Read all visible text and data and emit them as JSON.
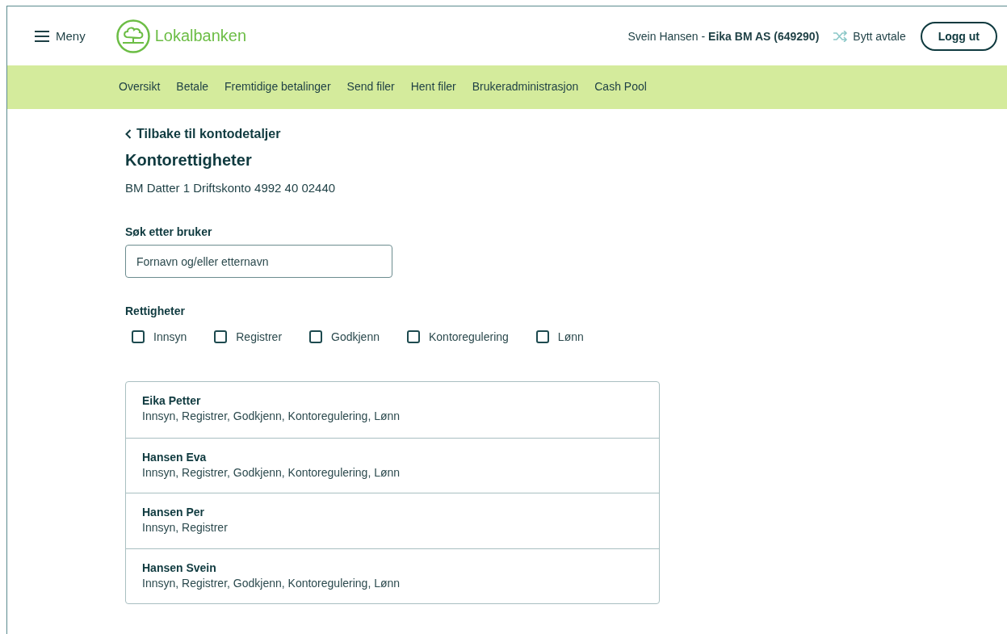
{
  "header": {
    "menu_label": "Meny",
    "logo_text": "Lokalbanken",
    "account": "Svein Hansen - **Eika BM AS (649290)**",
    "switch_label": "Bytt avtale",
    "logout_label": "Logg ut"
  },
  "nav": [
    {
      "label": "Oversikt",
      "selected": false
    },
    {
      "label": "Betale",
      "selected": false
    },
    {
      "label": "Fremtidige betalinger",
      "selected": false
    },
    {
      "label": "Send filer",
      "selected": false
    },
    {
      "label": "Hent filer",
      "selected": false
    },
    {
      "label": "Brukeradministrasjon",
      "selected": false
    },
    {
      "label": "Cash Pool",
      "selected": false
    }
  ],
  "back_link": "Tilbake til kontodetaljer",
  "title": "Kontorettigheter",
  "account_line": "BM Datter 1 Driftskonto 4992 40 02440",
  "search": {
    "label": "Søk etter bruker",
    "placeholder": "Fornavn og/eller etternavn"
  },
  "rights": {
    "label": "Rettigheter",
    "options": [
      {
        "label": "Innsyn",
        "checked": false
      },
      {
        "label": "Registrer",
        "checked": false
      },
      {
        "label": "Godkjenn",
        "checked": false
      },
      {
        "label": "Kontoregulering",
        "checked": false
      },
      {
        "label": "Lønn",
        "checked": false
      }
    ]
  },
  "users": [
    {
      "name": "Eika Petter",
      "rights": "Innsyn, Registrer, Godkjenn, Kontoregulering, Lønn"
    },
    {
      "name": "Hansen Eva",
      "rights": "Innsyn, Registrer, Godkjenn, Kontoregulering, Lønn"
    },
    {
      "name": "Hansen Per",
      "rights": "Innsyn, Registrer"
    },
    {
      "name": "Hansen Svein",
      "rights": "Innsyn, Registrer, Godkjenn, Kontoregulering, Lønn"
    }
  ]
}
